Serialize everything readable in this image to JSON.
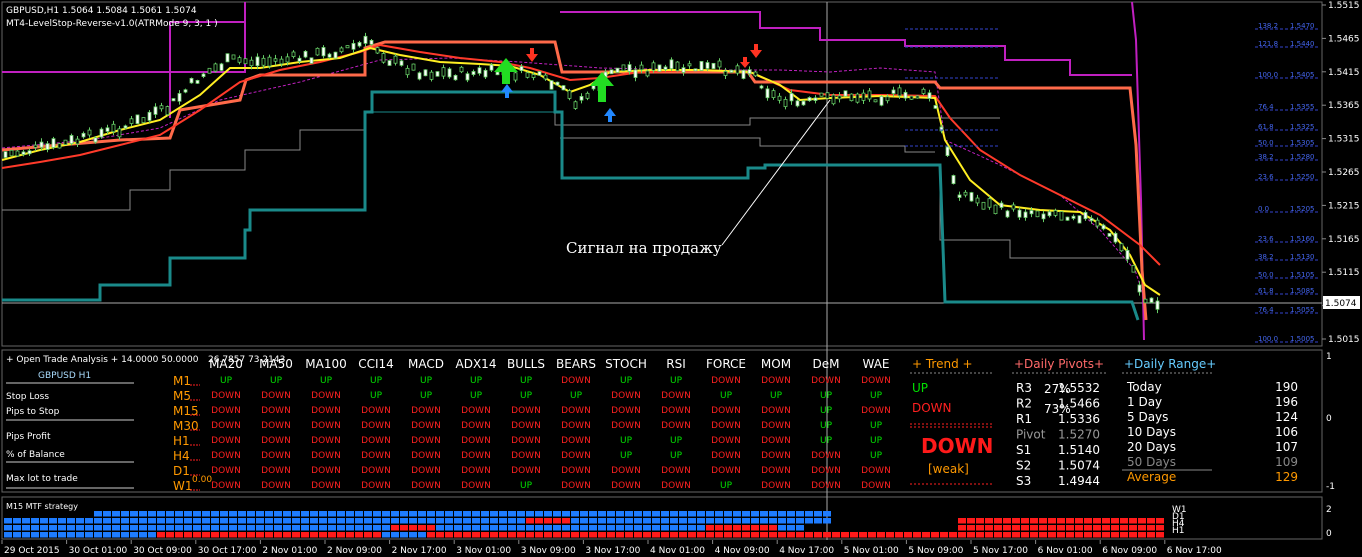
{
  "header": {
    "symbol_line": "GBPUSD,H1  1.5064 1.5084 1.5061 1.5074",
    "indicator_line": "MT4-LevelStop-Reverse-v1.0(ATRMode 9, 3, 1 )"
  },
  "annotation": "Сигнал на продажу",
  "current_price": "1.5074",
  "price_axis": [
    "1.5515",
    "1.5465",
    "1.5415",
    "1.5365",
    "1.5315",
    "1.5265",
    "1.5215",
    "1.5165",
    "1.5115",
    "1.5065",
    "1.5015"
  ],
  "fib_levels": [
    {
      "label": "138.2",
      "price": "1.5470"
    },
    {
      "label": "121.8",
      "price": "1.5440"
    },
    {
      "label": "100.0",
      "price": "1.5405"
    },
    {
      "label": "76.4",
      "price": "1.5355"
    },
    {
      "label": "61.8",
      "price": "1.5325"
    },
    {
      "label": "50.0",
      "price": "1.5305"
    },
    {
      "label": "38.2",
      "price": "1.5280"
    },
    {
      "label": "23.6",
      "price": "1.5250"
    },
    {
      "label": "0.0",
      "price": "1.5205"
    },
    {
      "label": "23.6",
      "price": "1.5160"
    },
    {
      "label": "38.2",
      "price": "1.5130"
    },
    {
      "label": "50.0",
      "price": "1.5105"
    },
    {
      "label": "61.8",
      "price": "1.5085"
    },
    {
      "label": "76.4",
      "price": "1.5055"
    },
    {
      "label": "100.0",
      "price": "1.5005"
    }
  ],
  "time_axis": [
    "29 Oct 2015",
    "30 Oct 01:00",
    "30 Oct 09:00",
    "30 Oct 17:00",
    "2 Nov 01:00",
    "2 Nov 09:00",
    "2 Nov 17:00",
    "3 Nov 01:00",
    "3 Nov 09:00",
    "3 Nov 17:00",
    "4 Nov 01:00",
    "4 Nov 09:00",
    "4 Nov 17:00",
    "5 Nov 01:00",
    "5 Nov 09:00",
    "5 Nov 17:00",
    "6 Nov 01:00",
    "6 Nov 09:00",
    "6 Nov 17:00"
  ],
  "panel": {
    "title": "+ Open Trade Analysis + 14.0000 50.0000",
    "extra_values": "26.7857 73.2143",
    "symbol": "GBPUSD  H1",
    "left_labels": [
      "Stop Loss",
      "Pips to Stop",
      "Pips Profit",
      "% of Balance",
      "Max lot to trade"
    ],
    "lot_value": "0.00",
    "percent_a": "27%",
    "percent_b": "73%",
    "scale_labels": [
      "1",
      "0",
      "-1"
    ]
  },
  "matrix": {
    "columns": [
      "MA20",
      "MA50",
      "MA100",
      "CCI14",
      "MACD",
      "ADX14",
      "BULLS",
      "BEARS",
      "STOCH",
      "RSI",
      "FORCE",
      "MOM",
      "DeM",
      "WAE"
    ],
    "rows": [
      {
        "tf": "M1",
        "cells": [
          "UP",
          "UP",
          "UP",
          "UP",
          "UP",
          "UP",
          "UP",
          "DOWN",
          "UP",
          "UP",
          "DOWN",
          "DOWN",
          "DOWN",
          "DOWN"
        ]
      },
      {
        "tf": "M5",
        "cells": [
          "DOWN",
          "DOWN",
          "DOWN",
          "UP",
          "UP",
          "UP",
          "UP",
          "UP",
          "DOWN",
          "DOWN",
          "UP",
          "UP",
          "UP",
          "UP"
        ]
      },
      {
        "tf": "M15",
        "cells": [
          "DOWN",
          "DOWN",
          "DOWN",
          "DOWN",
          "DOWN",
          "DOWN",
          "DOWN",
          "DOWN",
          "DOWN",
          "DOWN",
          "DOWN",
          "DOWN",
          "UP",
          "DOWN"
        ]
      },
      {
        "tf": "M30",
        "cells": [
          "DOWN",
          "DOWN",
          "DOWN",
          "DOWN",
          "DOWN",
          "DOWN",
          "DOWN",
          "DOWN",
          "DOWN",
          "DOWN",
          "DOWN",
          "DOWN",
          "UP",
          "UP"
        ]
      },
      {
        "tf": "H1",
        "cells": [
          "DOWN",
          "DOWN",
          "DOWN",
          "DOWN",
          "DOWN",
          "DOWN",
          "DOWN",
          "DOWN",
          "UP",
          "UP",
          "DOWN",
          "DOWN",
          "UP",
          "UP"
        ]
      },
      {
        "tf": "H4",
        "cells": [
          "DOWN",
          "DOWN",
          "DOWN",
          "DOWN",
          "DOWN",
          "DOWN",
          "DOWN",
          "DOWN",
          "UP",
          "UP",
          "DOWN",
          "DOWN",
          "DOWN",
          "UP"
        ]
      },
      {
        "tf": "D1",
        "cells": [
          "DOWN",
          "DOWN",
          "DOWN",
          "DOWN",
          "DOWN",
          "DOWN",
          "DOWN",
          "DOWN",
          "DOWN",
          "DOWN",
          "DOWN",
          "DOWN",
          "DOWN",
          "DOWN"
        ]
      },
      {
        "tf": "W1",
        "cells": [
          "DOWN",
          "DOWN",
          "DOWN",
          "DOWN",
          "DOWN",
          "DOWN",
          "UP",
          "DOWN",
          "DOWN",
          "DOWN",
          "UP",
          "DOWN",
          "DOWN",
          "DOWN"
        ]
      }
    ]
  },
  "trend": {
    "title": "+ Trend +",
    "up": "UP",
    "down": "DOWN",
    "signal": "DOWN",
    "strength": "[weak]"
  },
  "pivots": {
    "title": "+Daily Pivots+",
    "rows": [
      {
        "name": "R3",
        "value": "1.5532"
      },
      {
        "name": "R2",
        "value": "1.5466"
      },
      {
        "name": "R1",
        "value": "1.5336"
      },
      {
        "name": "Pivot",
        "value": "1.5270"
      },
      {
        "name": "S1",
        "value": "1.5140"
      },
      {
        "name": "S2",
        "value": "1.5074"
      },
      {
        "name": "S3",
        "value": "1.4944"
      }
    ]
  },
  "range": {
    "title": "+Daily Range+",
    "rows": [
      {
        "name": "Today",
        "value": "190"
      },
      {
        "name": "1 Day",
        "value": "196"
      },
      {
        "name": "5 Days",
        "value": "124"
      },
      {
        "name": "10 Days",
        "value": "106"
      },
      {
        "name": "20 Days",
        "value": "107"
      },
      {
        "name": "50 Days",
        "value": "109"
      },
      {
        "name": "Average",
        "value": "129"
      }
    ]
  },
  "mtf": {
    "title": "M15 MTF strategy",
    "rows": [
      "W1",
      "D1",
      "H4",
      "H1"
    ]
  },
  "colors": {
    "up": "#00e000",
    "down": "#ff2020",
    "blue_block": "#1e7cff",
    "red_block": "#ff1a1a",
    "grid": "#444"
  }
}
